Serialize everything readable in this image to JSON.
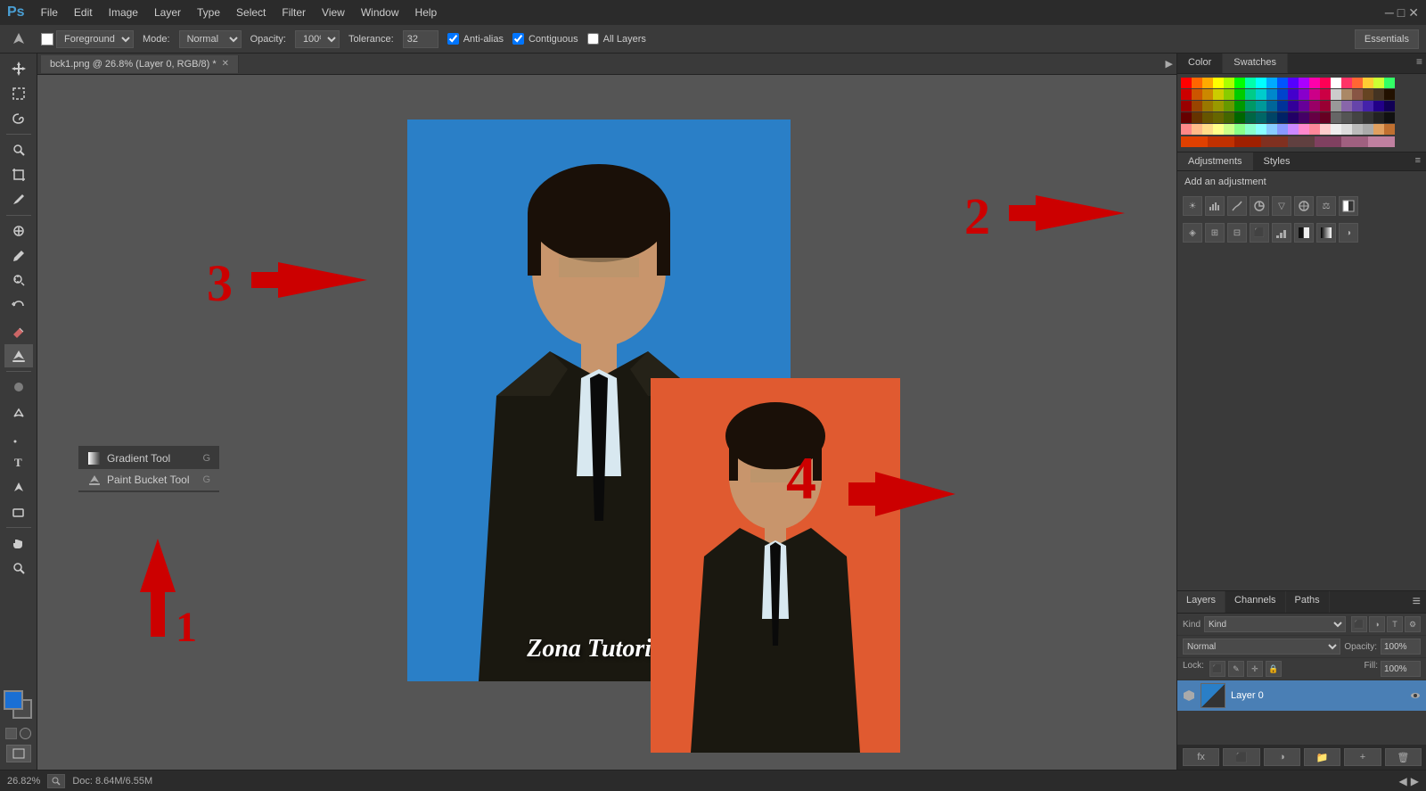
{
  "app": {
    "title": "Adobe Photoshop",
    "logo": "Ps"
  },
  "menu": {
    "items": [
      "File",
      "Edit",
      "Image",
      "Layer",
      "Type",
      "Select",
      "Filter",
      "View",
      "Window",
      "Help"
    ]
  },
  "options_bar": {
    "tool_label": "Foreground",
    "mode_label": "Mode:",
    "mode_value": "Normal",
    "opacity_label": "Opacity:",
    "opacity_value": "100%",
    "tolerance_label": "Tolerance:",
    "tolerance_value": "32",
    "anti_alias_label": "Anti-alias",
    "contiguous_label": "Contiguous",
    "all_layers_label": "All Layers",
    "essentials_label": "Essentials"
  },
  "tab": {
    "filename": "bck1.png @ 26.8% (Layer 0, RGB/8) *"
  },
  "canvas": {
    "main_photo_bg": "#2a7fc7",
    "result_photo_bg": "#e05a30",
    "watermark": "Zona Tutorial"
  },
  "annotations": {
    "label_1": "1",
    "label_2": "2",
    "label_3": "3",
    "label_4": "4"
  },
  "context_menu": {
    "items": [
      {
        "label": "Gradient Tool",
        "shortcut": "G",
        "icon": "gradient"
      },
      {
        "label": "Paint Bucket Tool",
        "shortcut": "G",
        "icon": "bucket"
      }
    ]
  },
  "right_panel": {
    "color_tab": "Color",
    "swatches_tab": "Swatches",
    "adjustments_panel": {
      "tabs": [
        "Adjustments",
        "Styles"
      ],
      "title": "Add an adjustment"
    },
    "layers_panel": {
      "tabs": [
        "Layers",
        "Channels",
        "Paths"
      ],
      "kind_label": "Kind",
      "mode_value": "Normal",
      "opacity_label": "Opacity:",
      "fill_label": "Fill:",
      "lock_label": "Lock:",
      "layers": [
        {
          "name": "Layer 0",
          "thumb": "layer0"
        }
      ]
    }
  },
  "status_bar": {
    "zoom": "26.82%",
    "doc_info": "Doc: 8.64M/6.55M"
  },
  "swatches": {
    "rows": [
      [
        "#ff0000",
        "#ff6600",
        "#ffaa00",
        "#ffff00",
        "#aaff00",
        "#00ff00",
        "#00ffaa",
        "#00ffff",
        "#00aaff",
        "#0055ff",
        "#5500ff",
        "#aa00ff",
        "#ff00aa",
        "#ff0055",
        "#ffffff"
      ],
      [
        "#cc0000",
        "#cc5500",
        "#cc8800",
        "#cccc00",
        "#88cc00",
        "#00cc00",
        "#00cc88",
        "#00cccc",
        "#0088cc",
        "#0044cc",
        "#4400cc",
        "#8800cc",
        "#cc0088",
        "#cc0044",
        "#cccccc"
      ],
      [
        "#990000",
        "#994400",
        "#997700",
        "#999900",
        "#669900",
        "#009900",
        "#009966",
        "#009999",
        "#006699",
        "#003399",
        "#330099",
        "#660099",
        "#990066",
        "#990033",
        "#999999"
      ],
      [
        "#660000",
        "#663300",
        "#665500",
        "#666600",
        "#446600",
        "#006600",
        "#006644",
        "#006666",
        "#004466",
        "#002266",
        "#220066",
        "#440066",
        "#660044",
        "#660022",
        "#666666"
      ],
      [
        "#330000",
        "#332200",
        "#333300",
        "#223300",
        "#003300",
        "#003322",
        "#003333",
        "#002233",
        "#001133",
        "#110033",
        "#220033",
        "#330022",
        "#330011",
        "#333333",
        "#000000"
      ],
      [
        "#ff8888",
        "#ffbb88",
        "#ffdd88",
        "#ffff88",
        "#ccff88",
        "#88ff88",
        "#88ffcc",
        "#88ffff",
        "#88ccff",
        "#8899ff",
        "#cc88ff",
        "#ff88cc",
        "#ff8899",
        "#ffcccc",
        "#eeeeee"
      ],
      [
        "#e04000",
        "#c03000",
        "#a02000",
        "#803020",
        "#604040",
        "#804060",
        "#a06080",
        "#c080a0",
        "#e0a0c0",
        "#ffc0e0",
        "#ffe0f0",
        "#ffd0d0",
        "#ffa0a0",
        "#ff7070",
        "#ff4040"
      ]
    ]
  }
}
